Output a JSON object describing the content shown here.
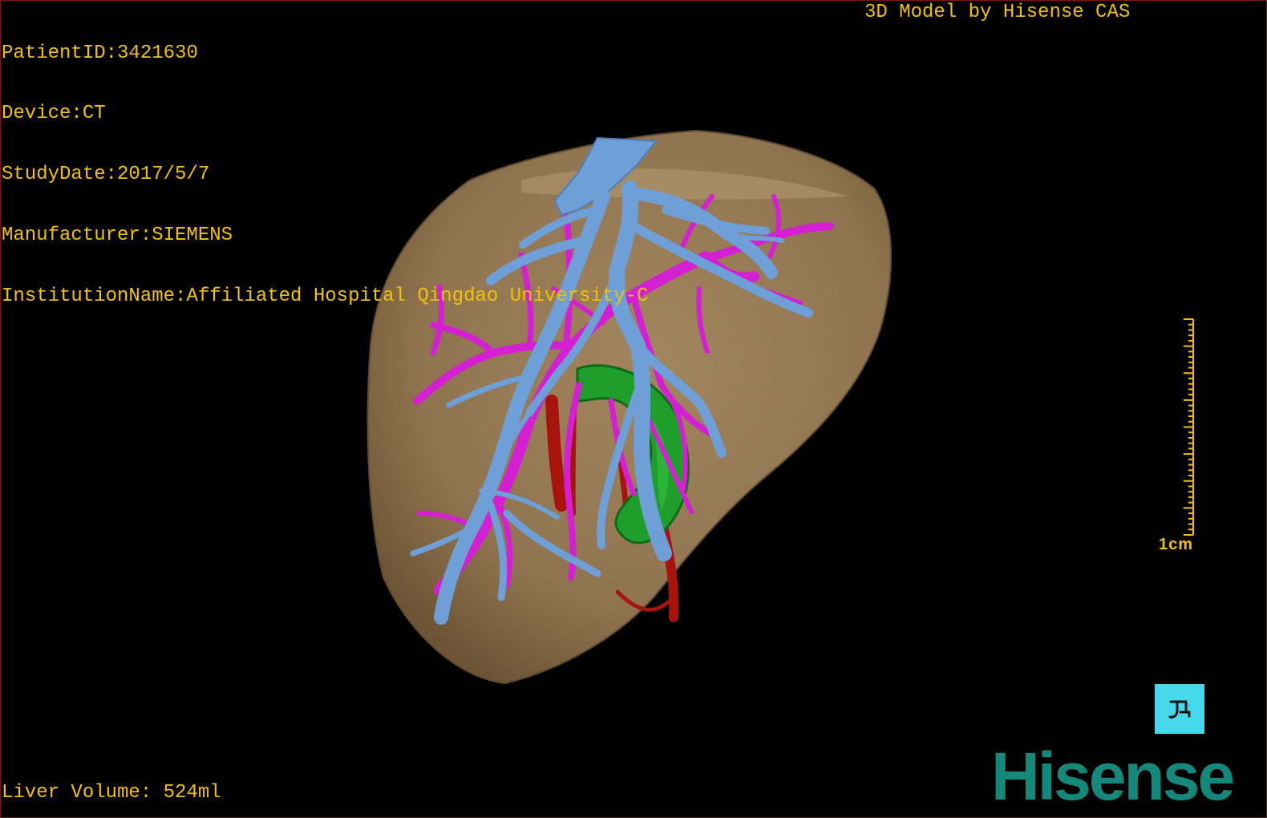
{
  "window": {
    "title_right": "3D Model by Hisense CAS"
  },
  "patient_info": [
    {
      "label": "PatientID:",
      "value": "3421630"
    },
    {
      "label": "Device:",
      "value": "CT"
    },
    {
      "label": "StudyDate:",
      "value": "2017/5/7"
    },
    {
      "label": "Manufacturer:",
      "value": "SIEMENS"
    },
    {
      "label": "InstitutionName:",
      "value": "Affiliated Hospital Qingdao University-C"
    }
  ],
  "measurement": {
    "label": "Liver Volume: ",
    "value": "524ml"
  },
  "scale_bar": {
    "label": "1cm"
  },
  "orientation_button": {
    "icon": "orientation-icon"
  },
  "logo": {
    "text": "Hisense"
  },
  "colors": {
    "background": "#000000",
    "overlay_text": "#f2c200",
    "logo": "#14887a",
    "orientation_button": "#44d8ea",
    "liver": "#8f7350",
    "hepatic_vein": "#6e9fd6",
    "portal_vein": "#d41fd2",
    "gallbladder": "#1f9e2c",
    "artery": "#a8130e"
  }
}
